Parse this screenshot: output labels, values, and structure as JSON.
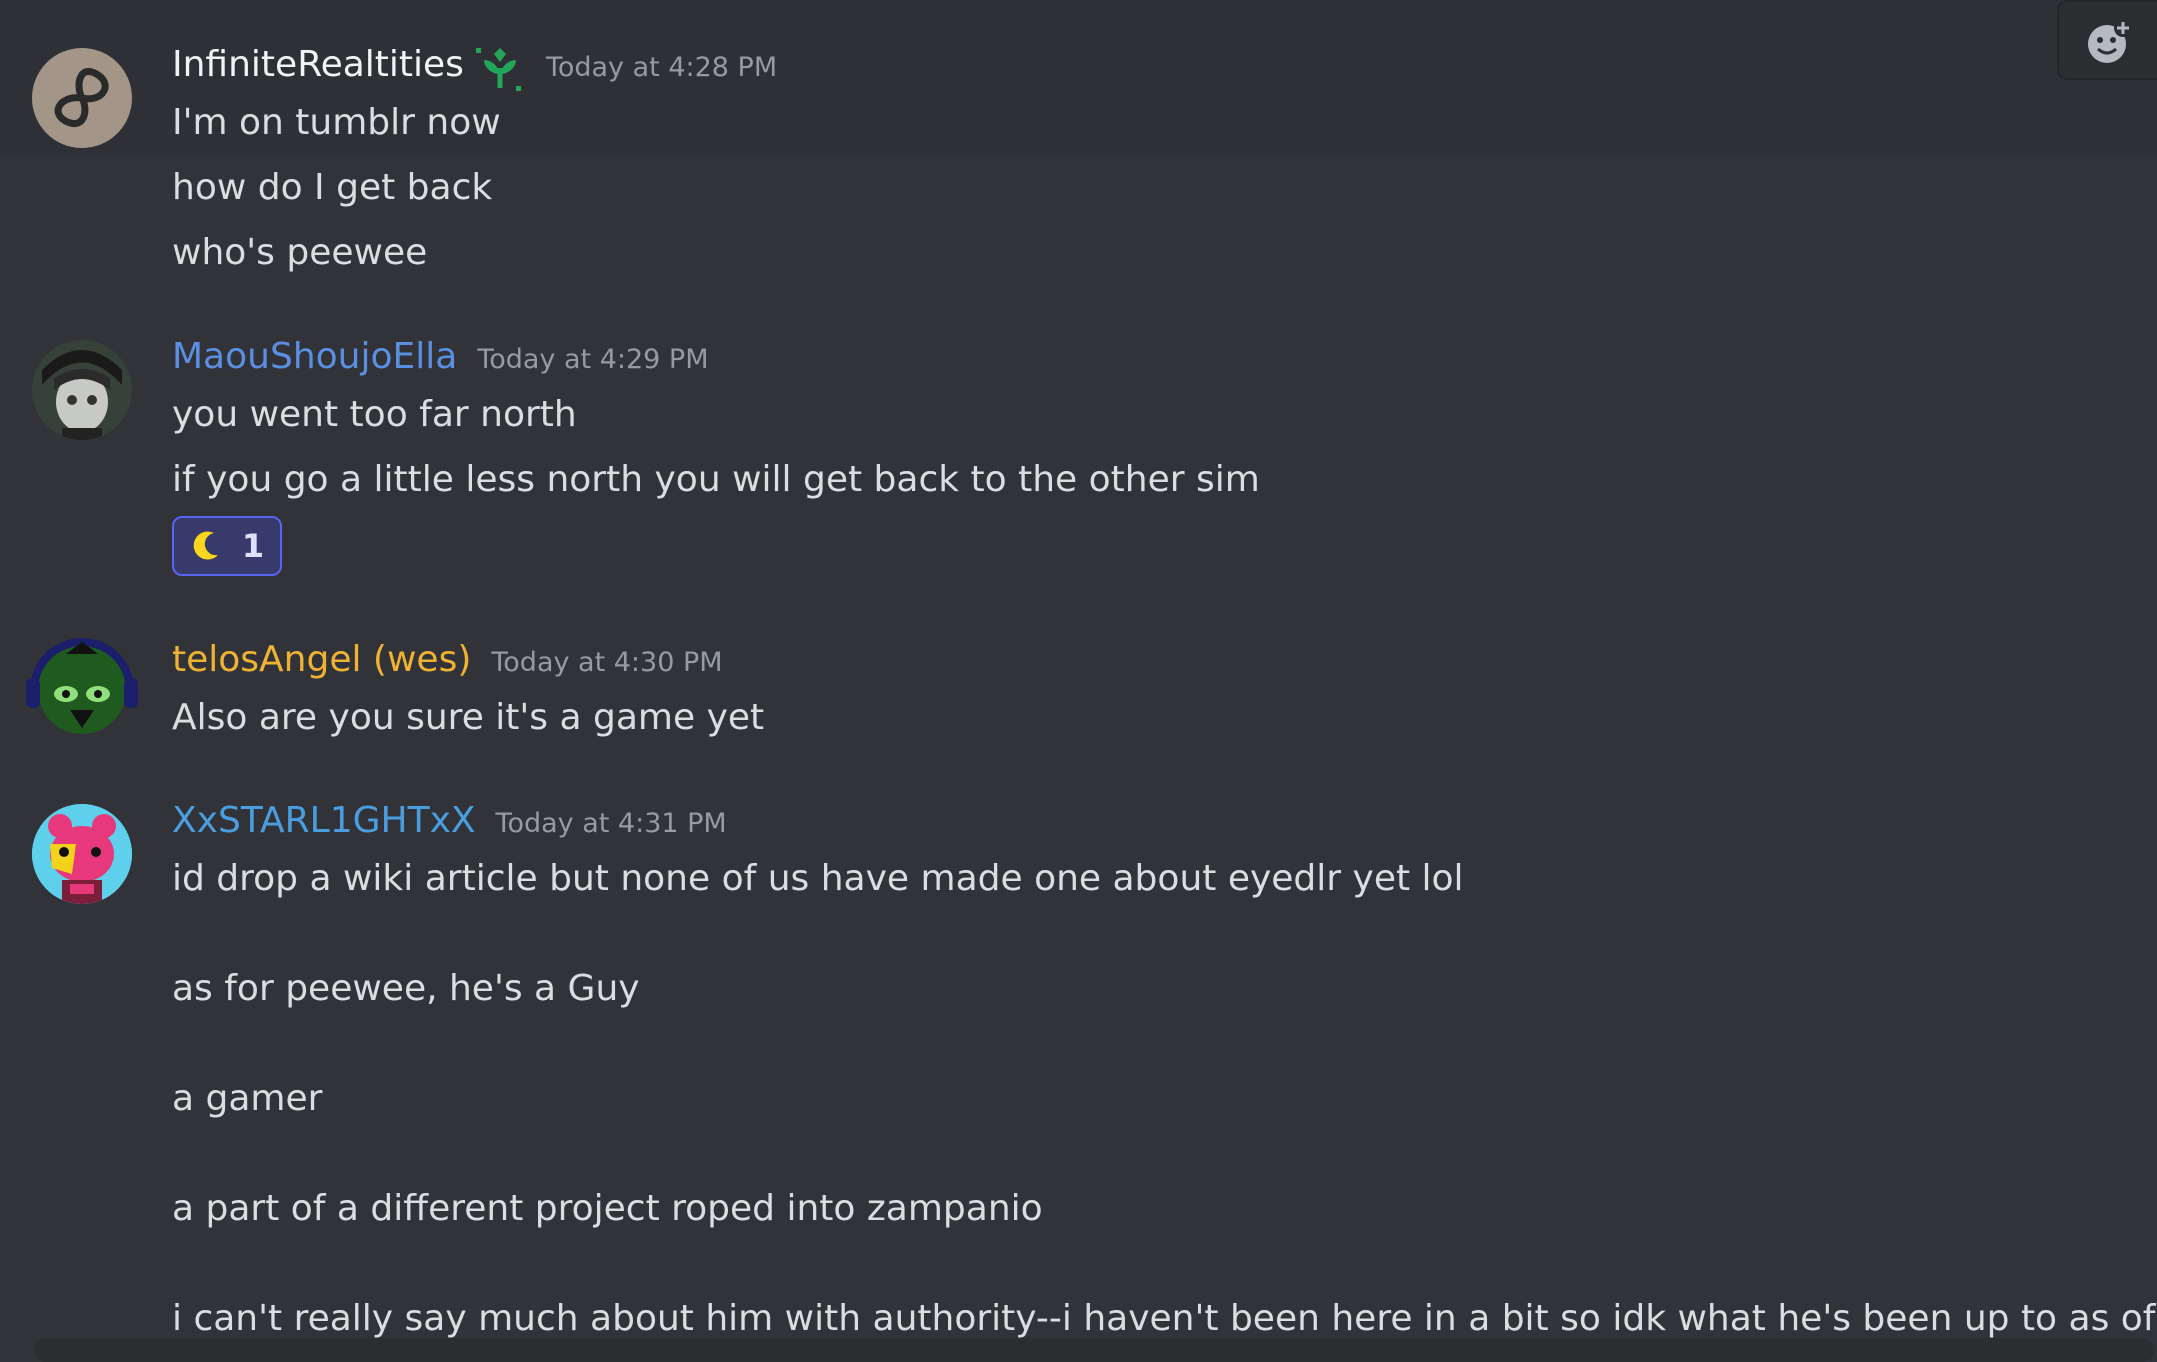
{
  "messages": [
    {
      "username": "InfiniteRealtities",
      "username_color": "#f2f3f5",
      "timestamp": "Today at 4:28 PM",
      "lines": [
        "I'm on tumblr now",
        "how do I get back",
        "who's peewee"
      ]
    },
    {
      "username": "MaouShoujoElla",
      "username_color": "#5b8fe3",
      "timestamp": "Today at 4:29 PM",
      "lines": [
        "you went too far north",
        "if you go a little less north you will get back to the other sim"
      ],
      "reaction": {
        "icon": "crescent-moon-icon",
        "count": "1"
      }
    },
    {
      "username": "telosAngel (wes)",
      "username_color": "#f0b232",
      "timestamp": "Today at 4:30 PM",
      "lines": [
        "Also are you sure it's a game yet"
      ]
    },
    {
      "username": "XxSTARL1GHTxX",
      "username_color": "#4a9ee0",
      "timestamp": "Today at 4:31 PM",
      "lines": [
        "id drop a wiki article but none of us have made one about eyedlr yet lol",
        "as for peewee, he's a Guy",
        "a gamer",
        "a part of a different project roped into zampanio",
        "i can't really say much about him with authority--i haven't been here in a bit so idk what he's been up to as of late"
      ]
    }
  ],
  "icons": {
    "badge": "sprout-badge-icon",
    "toolbar": "add-reaction-icon"
  }
}
